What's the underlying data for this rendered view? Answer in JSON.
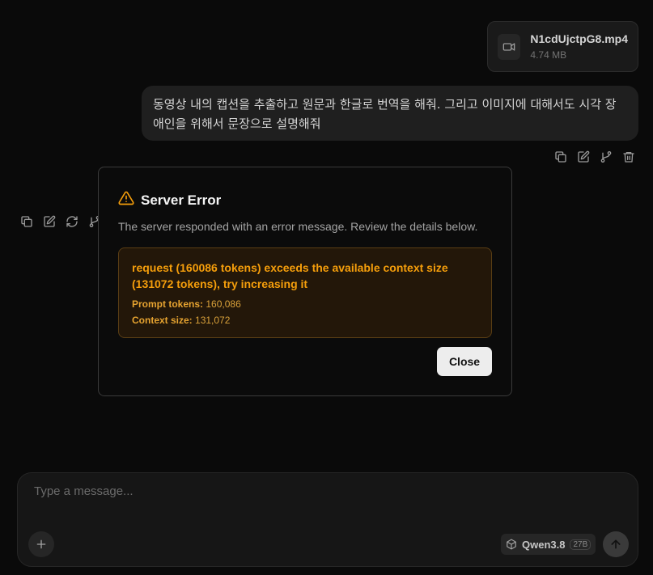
{
  "attachment": {
    "file_name": "N1cdUjctpG8.mp4",
    "file_size": "4.74 MB",
    "icon": "video-icon"
  },
  "user_message": {
    "text": "동영상 내의 캡션을 추출하고 원문과 한글로 번역을 해줘. 그리고 이미지에 대해서도 시각 장애인을 위해서 문장으로 설명해줘"
  },
  "user_actions": [
    "copy-icon",
    "edit-icon",
    "branch-icon",
    "trash-icon"
  ],
  "assistant_actions": [
    "copy-icon",
    "edit-icon",
    "regenerate-icon",
    "branch-icon"
  ],
  "error_dialog": {
    "title": "Server Error",
    "description": "The server responded with an error message. Review the details below.",
    "message": "request (160086 tokens) exceeds the available context size (131072 tokens), try increasing it",
    "prompt_tokens_label": "Prompt tokens:",
    "prompt_tokens_value": "160,086",
    "context_size_label": "Context size:",
    "context_size_value": "131,072",
    "close_label": "Close",
    "accent_color": "#f59e0b"
  },
  "composer": {
    "placeholder": "Type a message...",
    "model_name": "Qwen3.8",
    "model_size": "27B"
  }
}
